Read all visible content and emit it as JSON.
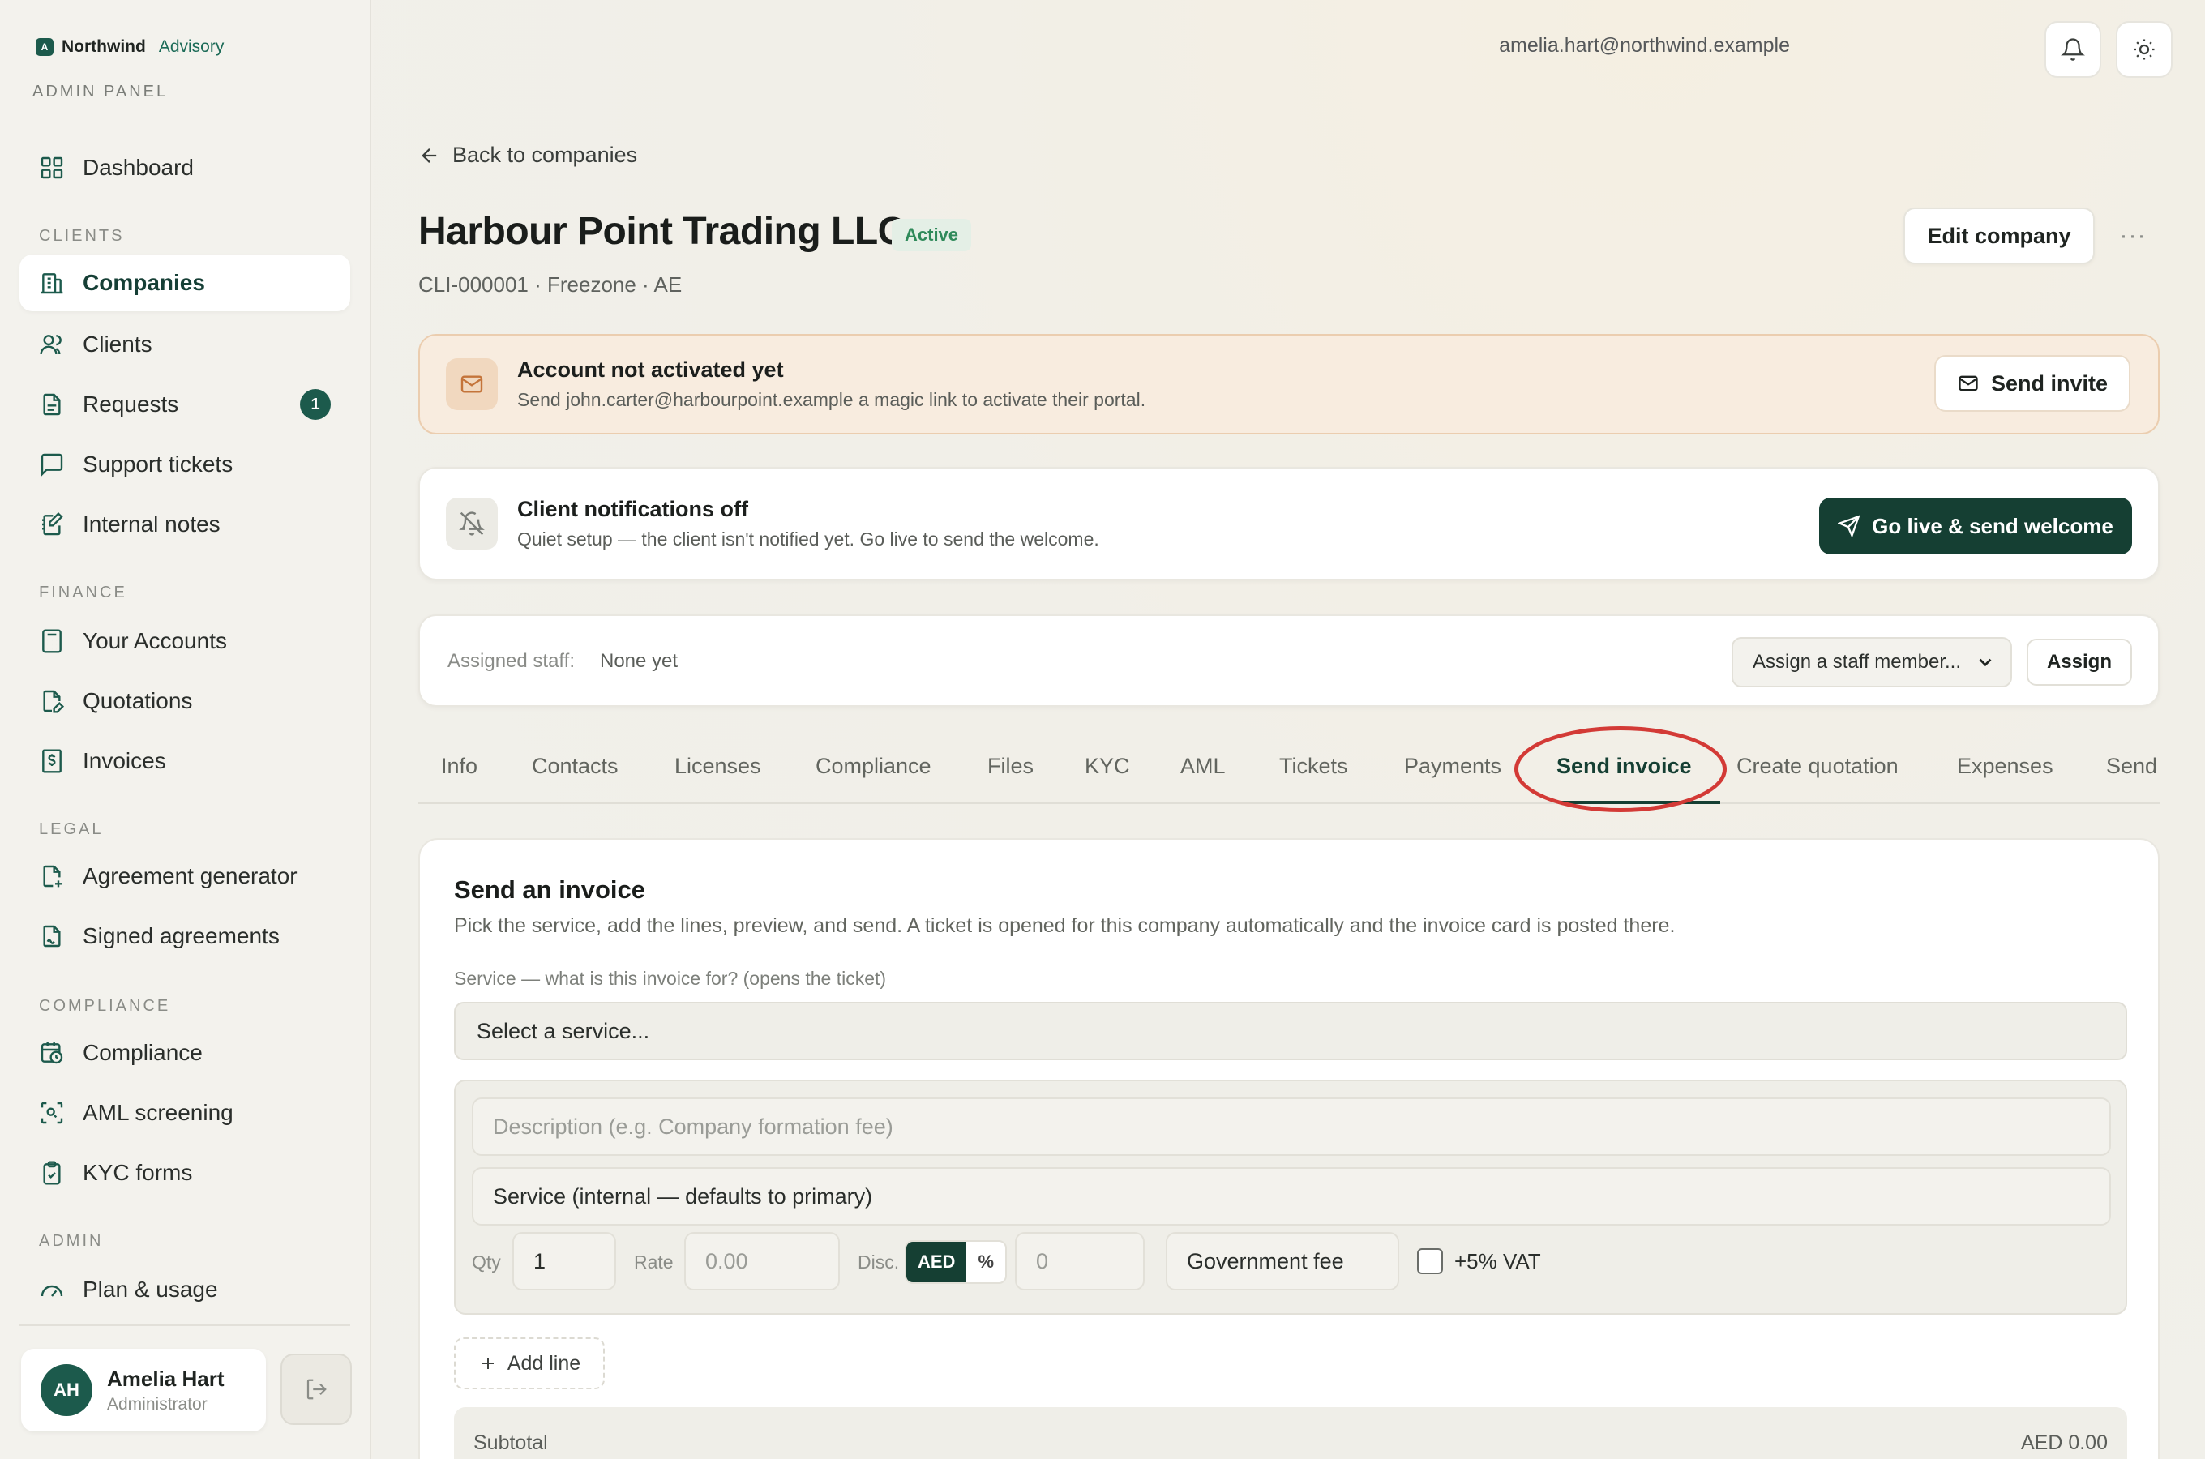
{
  "brand": {
    "name": "Northwind",
    "sub": "Advisory",
    "panel": "ADMIN PANEL"
  },
  "sidebar": {
    "sections": {
      "clients": "CLIENTS",
      "finance": "FINANCE",
      "legal": "LEGAL",
      "compliance": "COMPLIANCE",
      "admin": "ADMIN"
    },
    "items": {
      "dashboard": "Dashboard",
      "companies": "Companies",
      "clients": "Clients",
      "requests": "Requests",
      "requests_badge": "1",
      "support": "Support tickets",
      "notes": "Internal notes",
      "accounts": "Your Accounts",
      "quotations": "Quotations",
      "invoices": "Invoices",
      "agreement": "Agreement generator",
      "signed": "Signed agreements",
      "compliance": "Compliance",
      "aml": "AML screening",
      "kyc": "KYC forms",
      "plan": "Plan & usage"
    },
    "user": {
      "initials": "AH",
      "name": "Amelia Hart",
      "role": "Administrator"
    }
  },
  "topbar": {
    "email": "amelia.hart@northwind.example"
  },
  "page": {
    "back": "Back to companies",
    "title": "Harbour Point Trading LLC",
    "status": "Active",
    "meta": "CLI-000001 · Freezone · AE",
    "edit": "Edit company",
    "more": "···"
  },
  "banner_account": {
    "title": "Account not activated yet",
    "desc": "Send john.carter@harbourpoint.example a magic link to activate their portal.",
    "button": "Send invite"
  },
  "banner_notif": {
    "title": "Client notifications off",
    "desc": "Quiet setup — the client isn't notified yet. Go live to send the welcome.",
    "button": "Go live & send welcome"
  },
  "staff": {
    "label": "Assigned staff:",
    "value": "None yet",
    "select": "Assign a staff member...",
    "button": "Assign"
  },
  "tabs": {
    "info": "Info",
    "contacts": "Contacts",
    "licenses": "Licenses",
    "compliance": "Compliance",
    "files": "Files",
    "kyc": "KYC",
    "aml": "AML",
    "tickets": "Tickets",
    "payments": "Payments",
    "send_invoice": "Send invoice",
    "create_quotation": "Create quotation",
    "expenses": "Expenses",
    "send": "Send"
  },
  "invoice": {
    "title": "Send an invoice",
    "desc": "Pick the service, add the lines, preview, and send. A ticket is opened for this company automatically and the invoice card is posted there.",
    "service_label": "Service — what is this invoice for? (opens the ticket)",
    "service_select": "Select a service...",
    "description_placeholder": "Description (e.g. Company formation fee)",
    "service_internal": "Service (internal — defaults to primary)",
    "qty_label": "Qty",
    "qty_value": "1",
    "rate_label": "Rate",
    "rate_placeholder": "0.00",
    "disc_label": "Disc.",
    "disc_aed": "AED",
    "disc_pct": "%",
    "disc_placeholder": "0",
    "fee_type": "Government fee",
    "vat": "+5% VAT",
    "add_line": "Add line",
    "subtotal_label": "Subtotal",
    "subtotal_value": "AED 0.00"
  }
}
